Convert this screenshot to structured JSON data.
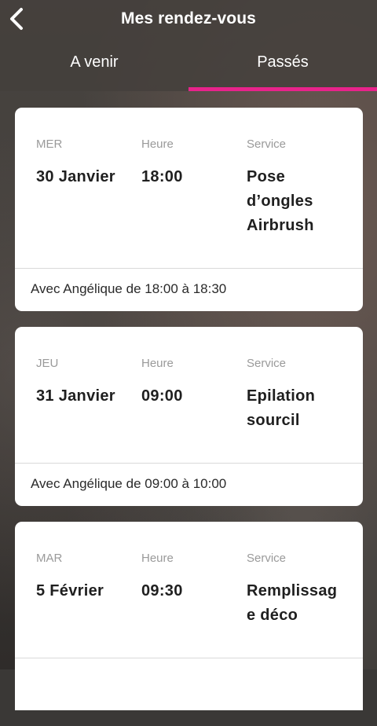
{
  "header": {
    "title": "Mes rendez-vous",
    "back_icon": "chevron-left-icon"
  },
  "tabs": [
    {
      "label": "A venir",
      "active": false
    },
    {
      "label": "Passés",
      "active": true
    }
  ],
  "accent_color": "#e8238b",
  "appointments": [
    {
      "day": "MER",
      "date": "30 Janvier",
      "time_label": "Heure",
      "time": "18:00",
      "service_label": "Service",
      "service": "Pose d’ongles Airbrush",
      "footer": "Avec Angélique de 18:00 à 18:30"
    },
    {
      "day": "JEU",
      "date": "31 Janvier",
      "time_label": "Heure",
      "time": "09:00",
      "service_label": "Service",
      "service": "Epilation sourcil",
      "footer": "Avec Angélique de 09:00 à 10:00"
    },
    {
      "day": "MAR",
      "date": "5 Février",
      "time_label": "Heure",
      "time": "09:30",
      "service_label": "Service",
      "service": "Remplissage déco",
      "footer": ""
    }
  ]
}
